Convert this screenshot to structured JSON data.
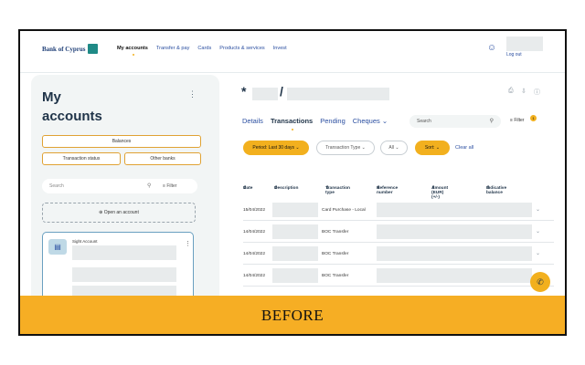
{
  "brand": {
    "name": "Bank of Cyprus"
  },
  "nav": {
    "items": [
      "My accounts",
      "Transfer & pay",
      "Cards",
      "Products & services",
      "Invest"
    ],
    "active": "My accounts"
  },
  "user": {
    "logout_label": "Log out"
  },
  "left": {
    "title_line1": "My",
    "title_line2": "accounts",
    "balances_label": "Balances",
    "transaction_status_label": "Transaction status",
    "other_banks_label": "Other banks",
    "search_placeholder": "Search",
    "filter_label": "Filter",
    "open_account_label": "Open an account",
    "account_name": "Sight Account"
  },
  "right": {
    "account_prefix": "*",
    "account_separator": "/",
    "tabs": [
      "Details",
      "Transactions",
      "Pending",
      "Cheques"
    ],
    "active_tab": "Transactions",
    "search_placeholder": "Search",
    "filter_label": "Filter",
    "filter_count": "1",
    "filters": {
      "period": "Period: Last 30 days",
      "transaction_type": "Transaction Type",
      "all": "All",
      "sort": "Sort:",
      "clear_all": "Clear all"
    },
    "columns": [
      "Date",
      "Description",
      "Transaction type",
      "Reference number",
      "Amount (EUR) (+/-)",
      "Indicative balance"
    ],
    "rows": [
      {
        "date": "15/04/2022",
        "type": "Card Purchase - Local"
      },
      {
        "date": "14/04/2022",
        "type": "BOC Transfer"
      },
      {
        "date": "14/04/2022",
        "type": "BOC Transfer"
      },
      {
        "date": "14/04/2022",
        "type": "BOC Transfer"
      }
    ]
  },
  "banner": {
    "text": "BEFORE"
  },
  "colors": {
    "accent": "#f2b01e",
    "brand_blue": "#2a4ea0",
    "panel_bg": "#f2f5f5"
  }
}
